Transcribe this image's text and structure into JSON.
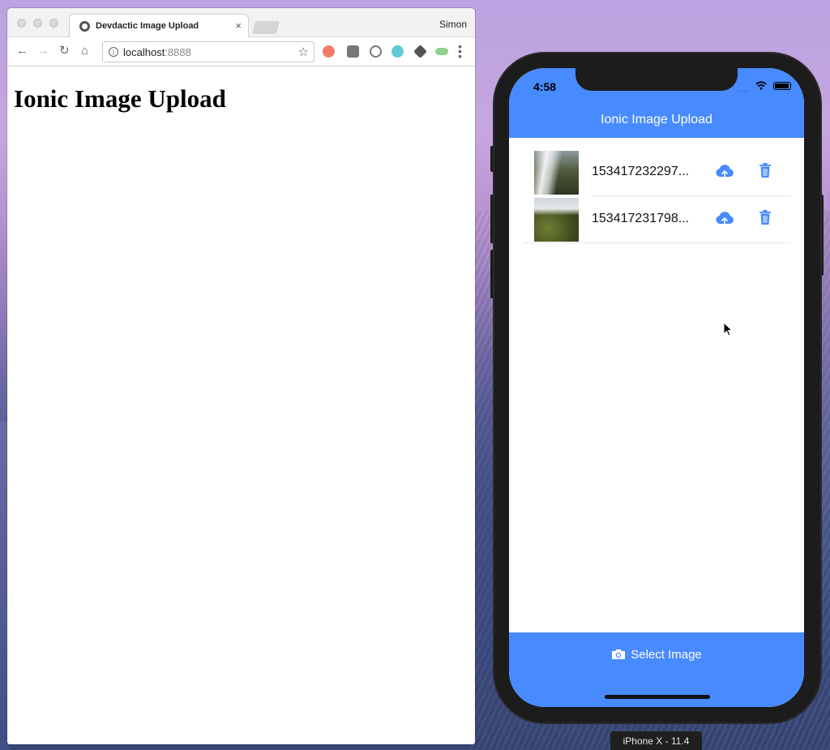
{
  "browser": {
    "tab_title": "Devdactic Image Upload",
    "tab_close": "×",
    "profile_name": "Simon",
    "url_host": "localhost",
    "url_port": ":8888",
    "page_heading": "Ionic Image Upload"
  },
  "app": {
    "status_time": "4:58",
    "status_signal": "....",
    "header_title": "Ionic Image Upload",
    "images": [
      {
        "name": "153417232297..."
      },
      {
        "name": "153417231798..."
      }
    ],
    "select_button_label": "Select Image",
    "accent_color": "#488aff"
  },
  "simulator": {
    "device_label": "iPhone X - 11.4"
  }
}
